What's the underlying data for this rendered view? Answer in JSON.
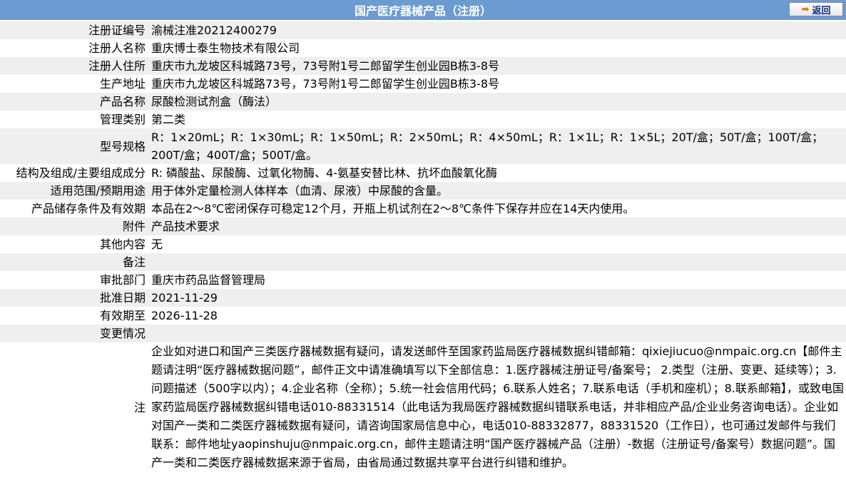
{
  "header": {
    "title": "国产医疗器械产品（注册）",
    "back_label": "返回"
  },
  "rows": [
    {
      "label": "注册证编号",
      "value": "渝械注准20212400279"
    },
    {
      "label": "注册人名称",
      "value": "重庆博士泰生物技术有限公司"
    },
    {
      "label": "注册人住所",
      "value": "重庆市九龙坡区科城路73号，73号附1号二郎留学生创业园B栋3-8号"
    },
    {
      "label": "生产地址",
      "value": "重庆市九龙坡区科城路73号，73号附1号二郎留学生创业园B栋3-8号"
    },
    {
      "label": "产品名称",
      "value": "尿酸检测试剂盒（酶法）"
    },
    {
      "label": "管理类别",
      "value": "第二类"
    },
    {
      "label": "型号规格",
      "value": "R：1×20mL；R：1×30mL；R：1×50mL；R：2×50mL；R：4×50mL；R：1×1L；R：1×5L；20T/盒；50T/盒；100T/盒；200T/盒；400T/盒；500T/盒。"
    },
    {
      "label": "结构及组成/主要组成成分",
      "value": "R: 磷酸盐、尿酸酶、过氧化物酶、4-氨基安替比林、抗坏血酸氧化酶"
    },
    {
      "label": "适用范围/预期用途",
      "value": "用于体外定量检测人体样本（血清、尿液）中尿酸的含量。"
    },
    {
      "label": "产品储存条件及有效期",
      "value": "本品在2～8℃密闭保存可稳定12个月，开瓶上机试剂在2～8℃条件下保存并应在14天内使用。"
    },
    {
      "label": "附件",
      "value": "产品技术要求"
    },
    {
      "label": "其他内容",
      "value": "无"
    },
    {
      "label": "备注",
      "value": ""
    },
    {
      "label": "审批部门",
      "value": "重庆市药品监督管理局"
    },
    {
      "label": "批准日期",
      "value": "2021-11-29"
    },
    {
      "label": "有效期至",
      "value": "2026-11-28"
    },
    {
      "label": "变更情况",
      "value": ""
    },
    {
      "label": "注",
      "value": "企业如对进口和国产三类医疗器械数据有疑问，请发送邮件至国家药监局医疗器械数据纠错邮箱：qixiejiucuo@nmpaic.org.cn【邮件主题请注明“医疗器械数据问题”，邮件正文中请准确填写以下全部信息：1.医疗器械注册证号/备案号； 2.类型（注册、变更、延续等）；3.问题描述（500字以内）；4.企业名称（全称）；5.统一社会信用代码；6.联系人姓名；7.联系电话（手机和座机）；8.联系邮箱】，或致电国家药监局医疗器械数据纠错电话010-88331514（此电话为我局医疗器械数据纠错联系电话，并非相应产品/企业业务咨询电话）。企业如对国产一类和二类医疗器械数据有疑问，请咨询国家局信息中心，电话010-88332877，88331520（工作日），也可通过发邮件与我们联系：邮件地址yaopinshuju@nmpaic.org.cn，邮件主题请注明“国产医疗器械产品（注册）-数据（注册证号/备案号）数据问题”。国产一类和二类医疗器械数据来源于省局，由省局通过数据共享平台进行纠错和维护。"
    }
  ]
}
